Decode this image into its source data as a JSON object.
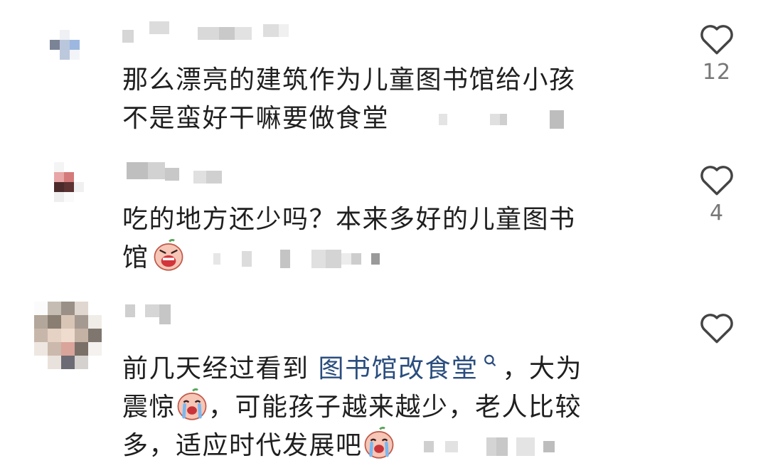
{
  "comments": [
    {
      "text_line1": "那么漂亮的建筑作为儿童图书馆给小孩",
      "text_line2": "不是蛮好干嘛要做食堂",
      "like_count": "12"
    },
    {
      "text_line1": "吃的地方还少吗？本来多好的儿童图书",
      "text_line2_prefix": "馆",
      "emoji": "screaming-face-emoji",
      "like_count": "4"
    },
    {
      "text_line1_prefix": "前几天经过看到 ",
      "link_text": "图书馆改食堂",
      "text_line1_suffix": "，大为",
      "text_line2_prefix": "震惊",
      "text_line2_suffix": "，可能孩子越来越少，老人比较",
      "text_line3_prefix": "多，适应时代发展吧",
      "emoji": "crying-face-emoji",
      "like_count": ""
    }
  ],
  "colors": {
    "link": "#2a4d7e",
    "text": "#1f1f1f",
    "count": "#777777",
    "heart": "#444444"
  },
  "icons": {
    "like": "heart-outline-icon",
    "search": "search-icon"
  }
}
